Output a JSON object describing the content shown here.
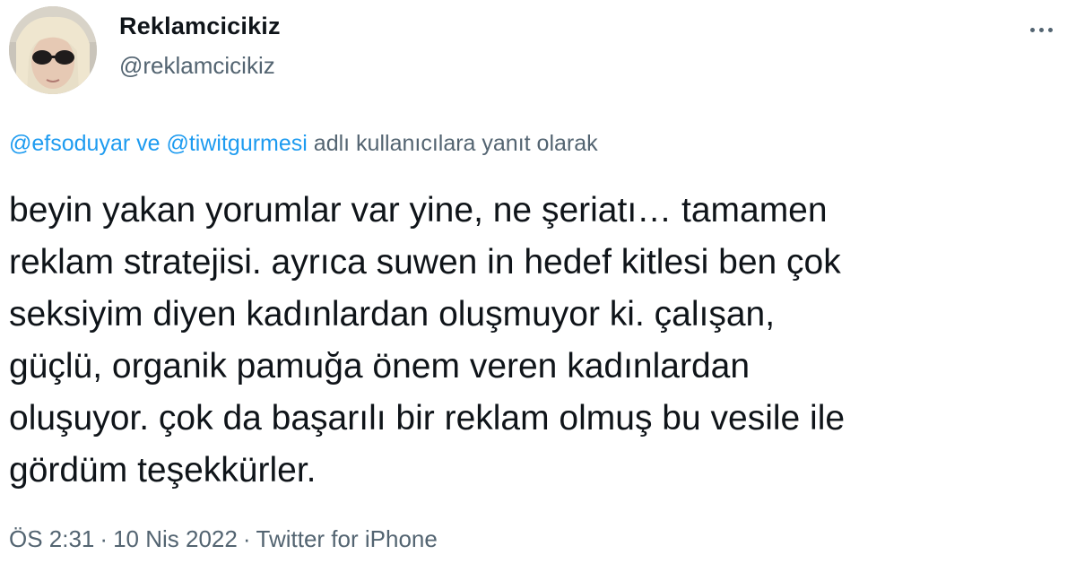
{
  "author": {
    "display_name": "Reklamcicikiz",
    "handle": "@reklamcicikiz"
  },
  "reply_context": {
    "mention_1": "@efsoduyar",
    "connector": "ve",
    "mention_2": "@tiwitgurmesi",
    "suffix": "adlı kullanıcılara yanıt olarak"
  },
  "tweet": {
    "lines": [
      "beyin yakan yorumlar var yine, ne şeriatı… tamamen",
      "reklam stratejisi. ayrıca suwen in hedef kitlesi ben çok",
      "seksiyim diyen kadınlardan oluşmuyor ki. çalışan,",
      "güçlü, organik pamuğa önem veren kadınlardan",
      "oluşuyor. çok da başarılı bir reklam olmuş bu vesile ile",
      "gördüm teşekkürler."
    ]
  },
  "meta": {
    "time": "ÖS 2:31",
    "separator": "·",
    "date": "10 Nis 2022",
    "source": "Twitter for iPhone"
  },
  "icons": {
    "more": "more-horizontal-icon"
  },
  "colors": {
    "text": "#0f1419",
    "secondary": "#536471",
    "link": "#1d9bf0"
  }
}
